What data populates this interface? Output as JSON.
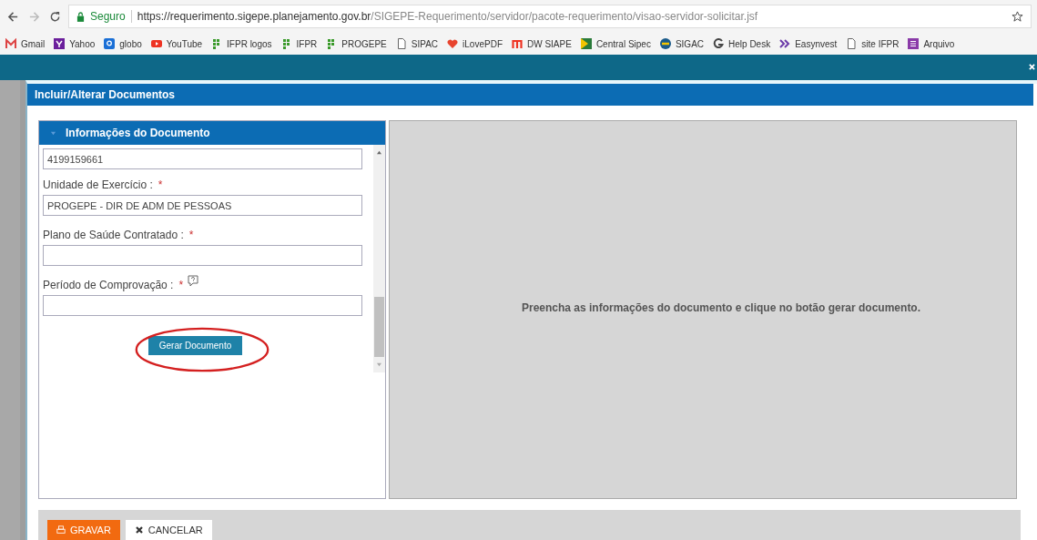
{
  "browser": {
    "security_label": "Seguro",
    "url_host": "https://requerimento.sigepe.planejamento.gov.br",
    "url_path": "/SIGEPE-Requerimento/servidor/pacote-requerimento/visao-servidor-solicitar.jsf"
  },
  "bookmarks": [
    {
      "label": "Gmail",
      "kind": "mail"
    },
    {
      "label": "Yahoo",
      "kind": "yahoo"
    },
    {
      "label": "globo",
      "kind": "globo"
    },
    {
      "label": "YouTube",
      "kind": "video"
    },
    {
      "label": "IFPR logos",
      "kind": "dots"
    },
    {
      "label": "IFPR",
      "kind": "dots"
    },
    {
      "label": "PROGEPE",
      "kind": "dots"
    },
    {
      "label": "SIPAC",
      "kind": "page"
    },
    {
      "label": "iLovePDF",
      "kind": "heart"
    },
    {
      "label": "DW SIAPE",
      "kind": "m"
    },
    {
      "label": "Central Sipec",
      "kind": "flag"
    },
    {
      "label": "SIGAC",
      "kind": "circle"
    },
    {
      "label": "Help Desk",
      "kind": "g"
    },
    {
      "label": "Easynvest",
      "kind": "chevrons"
    },
    {
      "label": "site IFPR",
      "kind": "page"
    },
    {
      "label": "Arquivo",
      "kind": "list"
    }
  ],
  "dialog": {
    "title": "Incluir/Alterar Documentos",
    "section": {
      "title": "Informações do Documento",
      "expanded": true
    },
    "fields": [
      {
        "value": "4199159661"
      },
      {
        "label": "Unidade de Exercício :",
        "required": true,
        "help": false,
        "value": "PROGEPE - DIR DE ADM DE PESSOAS"
      },
      {
        "label": "Plano de Saúde Contratado :",
        "required": true,
        "help": false
      },
      {
        "label": "Período de Comprovação :",
        "required": true,
        "help": true
      }
    ],
    "required_mark": "*",
    "generate_button": "Gerar Documento",
    "preview_message": "Preencha as informações do documento e clique no botão gerar documento.",
    "buttons": [
      {
        "label": "GRAVAR",
        "kind": "primary"
      },
      {
        "label": "CANCELAR",
        "kind": "secondary"
      }
    ]
  }
}
